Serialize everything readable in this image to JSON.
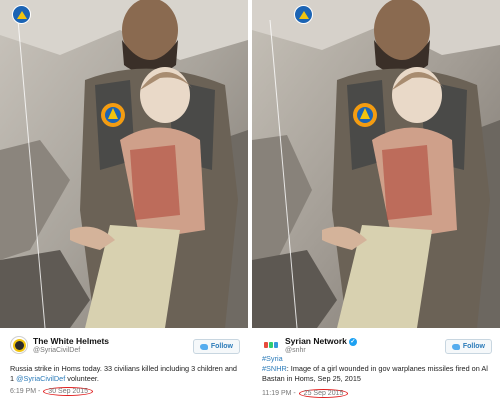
{
  "left": {
    "account_name": "The White Helmets",
    "handle": "@SyriaCivilDef",
    "follow_label": "Follow",
    "tweet_text_1": "Russia strike in Homs today. 33 civilians killed including 3 children and 1 ",
    "tweet_mention": "@SyriaCivilDef",
    "tweet_text_2": " volunteer.",
    "time": "6:19 PM - ",
    "date": "30 Sep 2015"
  },
  "right": {
    "account_name": "Syrian Network",
    "handle": "@snhr",
    "follow_label": "Follow",
    "hashtag_1": "#Syria",
    "hashtag_2": "#SNHR",
    "tweet_text": ": Image of a girl wounded in gov warplanes missiles fired on Al Bastan in Homs, Sep 25, 2015",
    "time": "11:19 PM - ",
    "date": "25 Sep 2015"
  },
  "colors": {
    "highlight_circle": "#e02020",
    "link": "#2b7bb9",
    "logo_blue": "#1c64b4",
    "logo_yellow": "#f1c40f"
  },
  "icons": {
    "logo": "white-helmets-emblem-icon",
    "follow": "twitter-bird-icon",
    "verified": "verified-check-icon"
  }
}
